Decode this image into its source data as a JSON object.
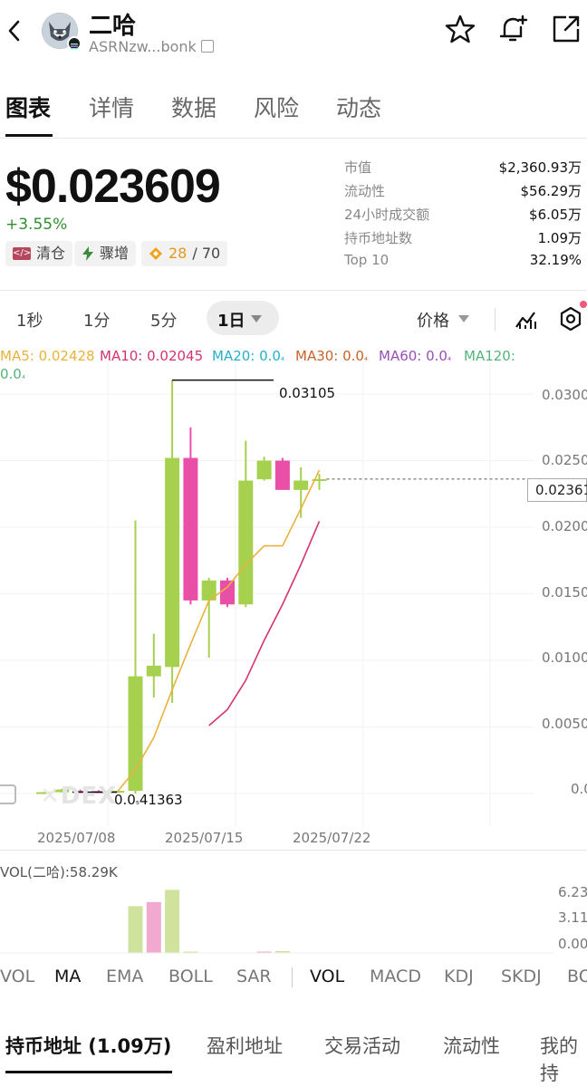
{
  "header": {
    "back": "‹",
    "token_name": "二哈",
    "address": "ASRNzw...bonk"
  },
  "tabs": [
    "图表",
    "详情",
    "数据",
    "风险",
    "动态"
  ],
  "price": {
    "value": "$0.023609",
    "change": "+3.55%",
    "tags": {
      "clear": "清仓",
      "surge": "骤增",
      "score": "28",
      "score_total": "/ 70"
    }
  },
  "stats": [
    {
      "label": "市值",
      "value": "$2,360.93万"
    },
    {
      "label": "流动性",
      "value": "$56.29万"
    },
    {
      "label": "24小时成交额",
      "value": "$6.05万"
    },
    {
      "label": "持币地址数",
      "value": "1.09万"
    },
    {
      "label": "Top 10",
      "value": "32.19%"
    }
  ],
  "intervals": [
    "1秒",
    "1分",
    "5分",
    "1日"
  ],
  "price_selector": "价格",
  "ma_legend": {
    "ma5": "MA5: 0.02428",
    "ma10": "MA10: 0.02045",
    "ma20": "MA20: 0.0",
    "ma30": "MA30: 0.0",
    "ma60": "MA60: 0.0",
    "ma120": "MA120:",
    "ma120_cont": "0.0",
    "sub": "₄"
  },
  "chart_labels": {
    "high": "0.03105",
    "low": "0.0",
    "low_sub": "₅",
    "low_tail": "41363",
    "current": "0.02361",
    "watermark": "DEX"
  },
  "colors": {
    "up": "#a6d14f",
    "down": "#ea4fa8",
    "ma5": "#e8b23b",
    "ma10": "#d4336f",
    "ma20": "#27b0c8",
    "ma30": "#c8622a",
    "ma60": "#9a4fb8",
    "ma120": "#55b37a"
  },
  "chart_data": {
    "type": "candlestick",
    "x_ticks": [
      "2025/07/08",
      "2025/07/15",
      "2025/07/22"
    ],
    "y_ticks": [
      "0.0300",
      "0.0250",
      "0.0200",
      "0.0150",
      "0.0100",
      "0.0050",
      "0.0"
    ],
    "candles": [
      {
        "o": 5e-05,
        "h": 0.00012,
        "l": 4e-05,
        "c": 0.0001
      },
      {
        "o": 0.0001,
        "h": 0.00035,
        "l": 8e-05,
        "c": 0.0003
      },
      {
        "o": 0.0002,
        "h": 0.0003,
        "l": 0.00015,
        "c": 0.00018
      },
      {
        "o": 0.00018,
        "h": 0.00025,
        "l": 0.00012,
        "c": 0.00016
      },
      {
        "o": 0.00016,
        "h": 0.0002,
        "l": 0.0001,
        "c": 0.0002
      },
      {
        "o": 0.0002,
        "h": 0.0205,
        "l": 0.0,
        "c": 0.0088
      },
      {
        "o": 0.0088,
        "h": 0.012,
        "l": 0.0072,
        "c": 0.0096
      },
      {
        "o": 0.0095,
        "h": 0.03105,
        "l": 0.0068,
        "c": 0.0252
      },
      {
        "o": 0.0252,
        "h": 0.0275,
        "l": 0.0142,
        "c": 0.0145
      },
      {
        "o": 0.0145,
        "h": 0.0162,
        "l": 0.0102,
        "c": 0.016
      },
      {
        "o": 0.016,
        "h": 0.0162,
        "l": 0.014,
        "c": 0.0142
      },
      {
        "o": 0.0142,
        "h": 0.0265,
        "l": 0.014,
        "c": 0.0235
      },
      {
        "o": 0.0236,
        "h": 0.0253,
        "l": 0.0235,
        "c": 0.025
      },
      {
        "o": 0.025,
        "h": 0.0252,
        "l": 0.0228,
        "c": 0.0228
      },
      {
        "o": 0.0228,
        "h": 0.0245,
        "l": 0.0207,
        "c": 0.0235
      },
      {
        "o": 0.0235,
        "h": 0.024,
        "l": 0.0228,
        "c": 0.02361
      }
    ],
    "ma5": [
      {
        "i": 4,
        "v": 0.0001
      },
      {
        "i": 5,
        "v": 0.0018
      },
      {
        "i": 6,
        "v": 0.0042
      },
      {
        "i": 7,
        "v": 0.0078
      },
      {
        "i": 8,
        "v": 0.0112
      },
      {
        "i": 9,
        "v": 0.0145
      },
      {
        "i": 10,
        "v": 0.0155
      },
      {
        "i": 11,
        "v": 0.0172
      },
      {
        "i": 12,
        "v": 0.0186
      },
      {
        "i": 13,
        "v": 0.0186
      },
      {
        "i": 14,
        "v": 0.0214
      },
      {
        "i": 15,
        "v": 0.02428
      }
    ],
    "ma10": [
      {
        "i": 9,
        "v": 0.0051
      },
      {
        "i": 10,
        "v": 0.0063
      },
      {
        "i": 11,
        "v": 0.0085
      },
      {
        "i": 12,
        "v": 0.0115
      },
      {
        "i": 13,
        "v": 0.0142
      },
      {
        "i": 14,
        "v": 0.0172
      },
      {
        "i": 15,
        "v": 0.02045
      }
    ],
    "current": 0.02361
  },
  "volume": {
    "label": "VOL(二哈):58.29K",
    "y_ticks": [
      "6.23",
      "3.11",
      "0.00"
    ],
    "bars": [
      {
        "i": 5,
        "v": 4.6,
        "up": true
      },
      {
        "i": 6,
        "v": 5.0,
        "up": false
      },
      {
        "i": 7,
        "v": 6.2,
        "up": true
      },
      {
        "i": 8,
        "v": 0.12,
        "up": true
      },
      {
        "i": 12,
        "v": 0.08,
        "up": false
      },
      {
        "i": 13,
        "v": 0.18,
        "up": true
      }
    ]
  },
  "indicators": [
    "VOL",
    "MA",
    "EMA",
    "BOLL",
    "SAR",
    "VOL",
    "MACD",
    "KDJ",
    "SKDJ",
    "BO"
  ],
  "bottom_tabs": [
    "持币地址 (1.09万)",
    "盈利地址",
    "交易活动",
    "流动性",
    "我的持"
  ]
}
